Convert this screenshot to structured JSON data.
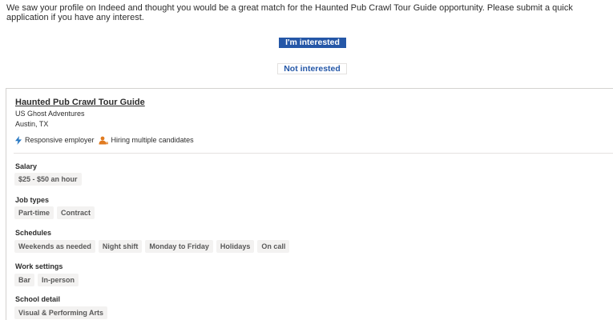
{
  "intro_text": "We saw your profile on Indeed and thought you would be a great match for the Haunted Pub Crawl Tour Guide opportunity. Please submit a quick application if you have any interest.",
  "buttons": {
    "interested": "I'm interested",
    "not_interested": "Not interested"
  },
  "job": {
    "title": "Haunted Pub Crawl Tour Guide",
    "company": "US Ghost Adventures",
    "location": "Austin, TX",
    "highlights": [
      {
        "icon": "lightning-icon",
        "label": "Responsive employer"
      },
      {
        "icon": "people-icon",
        "label": "Hiring multiple candidates"
      }
    ]
  },
  "details": {
    "salary": {
      "label": "Salary",
      "tags": [
        "$25 - $50 an hour"
      ]
    },
    "job_types": {
      "label": "Job types",
      "tags": [
        "Part-time",
        "Contract"
      ]
    },
    "schedules": {
      "label": "Schedules",
      "tags": [
        "Weekends as needed",
        "Night shift",
        "Monday to Friday",
        "Holidays",
        "On call"
      ]
    },
    "work_settings": {
      "label": "Work settings",
      "tags": [
        "Bar",
        "In-person"
      ]
    },
    "school_detail": {
      "label": "School detail",
      "tags": [
        "Visual & Performing Arts"
      ]
    }
  },
  "colors": {
    "primary": "#2557a7",
    "tag_bg": "#f3f2f1",
    "lightning": "#2b7ac4",
    "people": "#e07a1f"
  }
}
